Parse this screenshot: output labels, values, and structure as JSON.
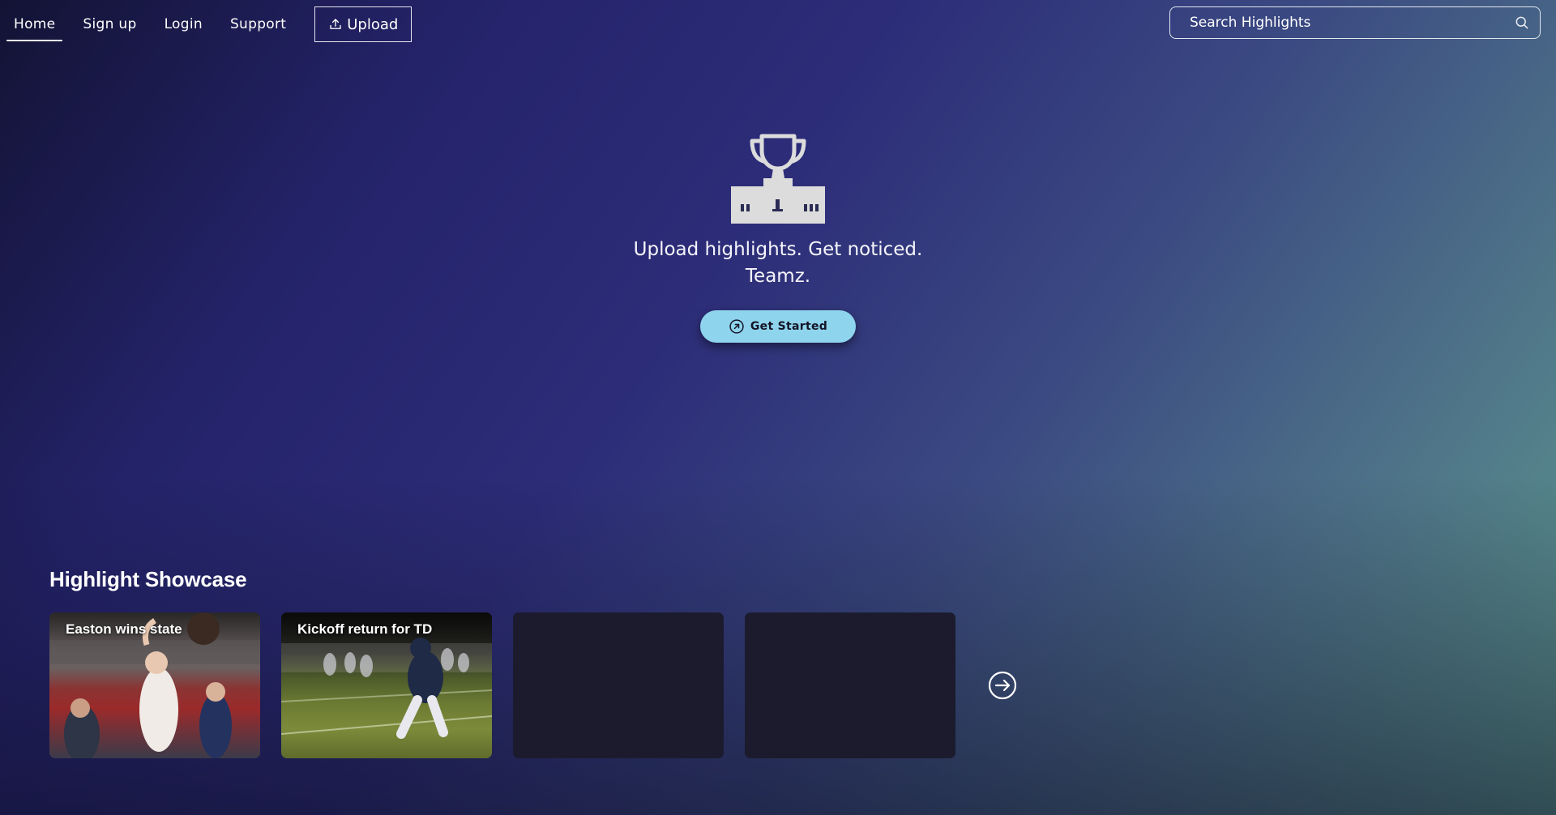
{
  "nav": {
    "items": [
      {
        "label": "Home",
        "active": true
      },
      {
        "label": "Sign up",
        "active": false
      },
      {
        "label": "Login",
        "active": false
      },
      {
        "label": "Support",
        "active": false
      }
    ],
    "upload_label": "Upload"
  },
  "search": {
    "placeholder": "Search Highlights",
    "value": ""
  },
  "hero": {
    "icon": "trophy-podium-icon",
    "tagline_line1": "Upload highlights. Get noticed.",
    "tagline_line2": "Teamz.",
    "cta_label": "Get Started",
    "cta_icon": "arrow-up-right-circle-icon"
  },
  "showcase": {
    "title": "Highlight Showcase",
    "cards": [
      {
        "title": "Easton wins state",
        "image": "basketball-game-photo"
      },
      {
        "title": "Kickoff return for TD",
        "image": "football-game-photo"
      },
      {
        "title": "",
        "image": ""
      },
      {
        "title": "",
        "image": ""
      }
    ],
    "next_icon": "arrow-right-circle-icon"
  },
  "colors": {
    "cta_background": "#8ed4ec",
    "card_placeholder": "#1c1b2e",
    "gradient_start": "#131335",
    "gradient_mid": "#2c2c78",
    "gradient_end": "#5e9a8e"
  }
}
